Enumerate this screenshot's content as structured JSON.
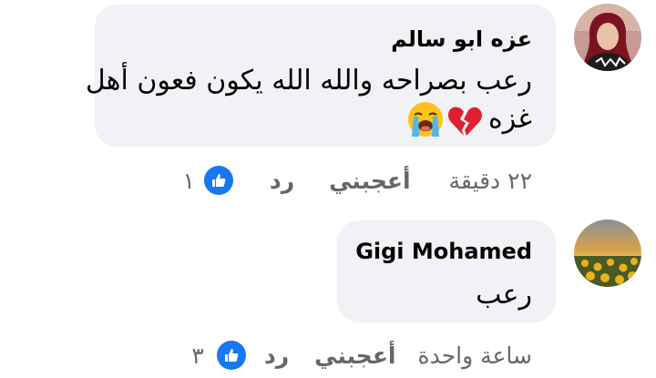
{
  "comments": [
    {
      "author": "عزه ابو سالم",
      "line1": "رعب بصراحه والله الله يكون فعون أهل",
      "line2": "غزه",
      "emojis": [
        "broken-heart-icon",
        "loudly-crying-face-icon"
      ],
      "time": "٢٢ دقيقة",
      "like_label": "أعجبني",
      "reply_label": "رد",
      "reaction_count": "١",
      "reaction_icon": "thumbs-up-icon"
    },
    {
      "author": "Gigi Mohamed",
      "line1": "رعب",
      "time": "ساعة واحدة",
      "like_label": "أعجبني",
      "reply_label": "رد",
      "reaction_count": "٣",
      "reaction_icon": "thumbs-up-icon"
    }
  ],
  "colors": {
    "bubble": "#f0f2f5",
    "text": "#050505",
    "meta": "#65676b",
    "like_blue": "#1877f2"
  }
}
